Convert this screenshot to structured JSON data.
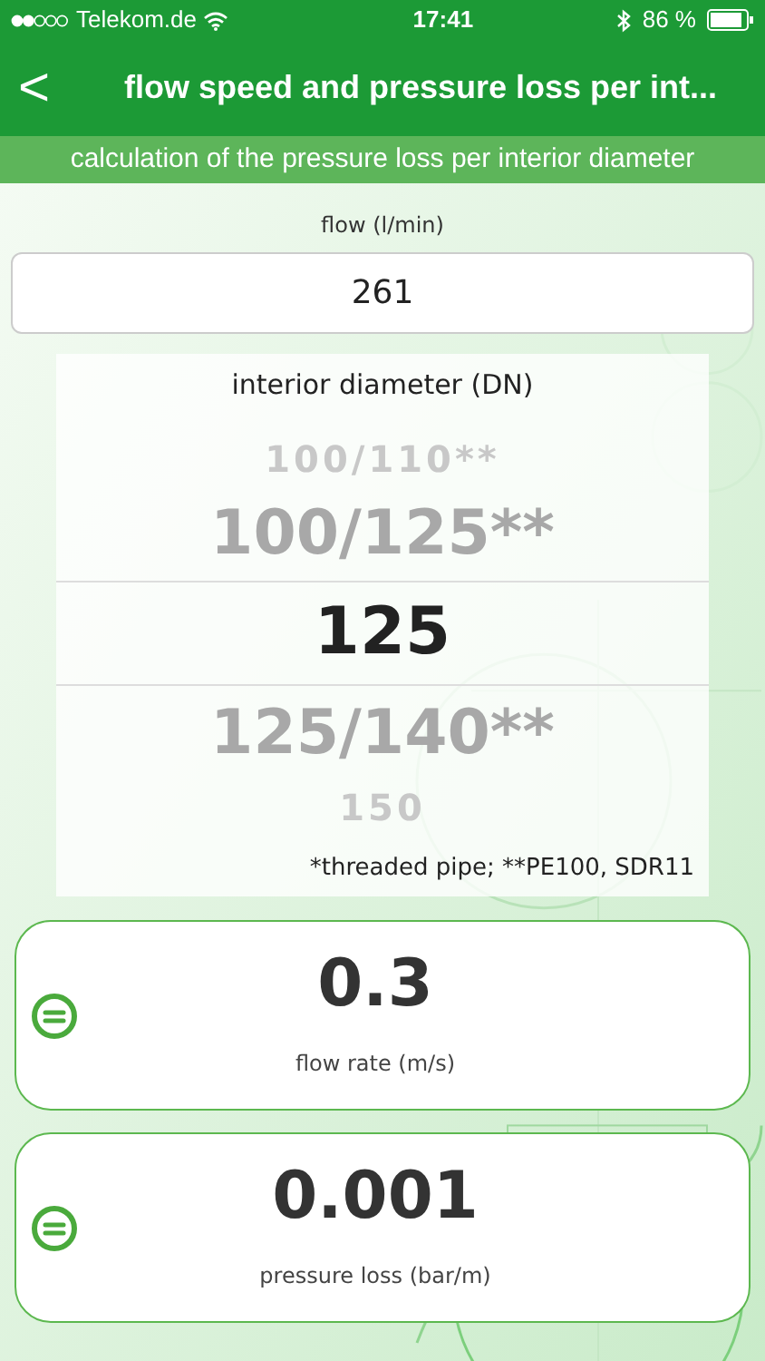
{
  "status_bar": {
    "carrier": "Telekom.de",
    "time": "17:41",
    "battery": "86 %"
  },
  "nav": {
    "back": "<",
    "title": "flow speed and pressure loss per int..."
  },
  "subtitle": "calculation of the pressure loss per interior diameter",
  "flow": {
    "label": "flow (l/min)",
    "value": "261"
  },
  "picker": {
    "label": "interior diameter (DN)",
    "items": [
      {
        "text": "100/110**",
        "selected": false
      },
      {
        "text": "100/125**",
        "selected": false
      },
      {
        "text": "125",
        "selected": true
      },
      {
        "text": "125/140**",
        "selected": false
      },
      {
        "text": "150",
        "selected": false
      }
    ],
    "footnote": "*threaded pipe; **PE100, SDR11"
  },
  "results": [
    {
      "value": "0.3",
      "label": "flow rate (m/s)"
    },
    {
      "value": "0.001",
      "label": "pressure loss (bar/m)"
    }
  ]
}
